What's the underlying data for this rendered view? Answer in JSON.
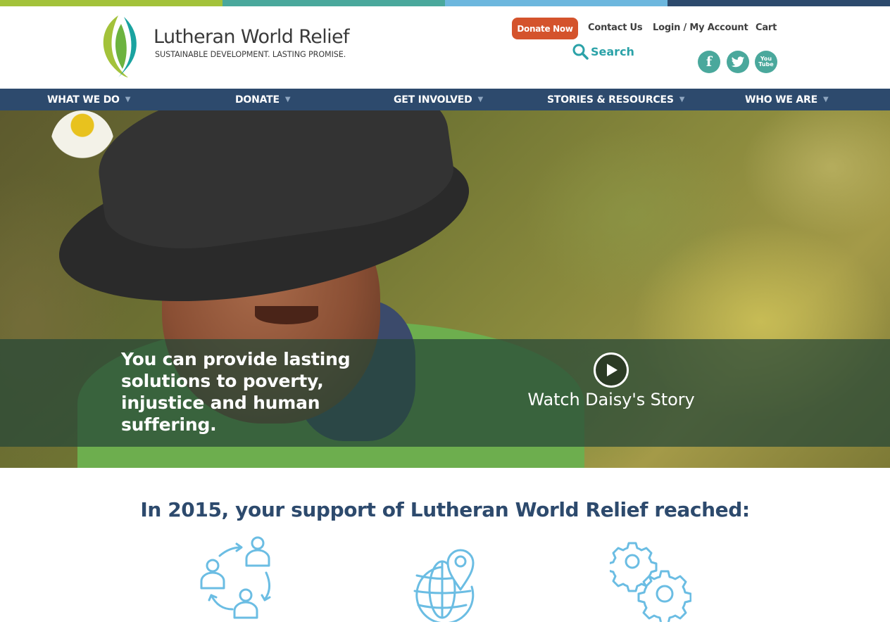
{
  "colors": {
    "strip": [
      "#a3c23a",
      "#4aa89c",
      "#6db7de",
      "#2d4a6d"
    ],
    "donate": "#d4532c",
    "nav": "#2d4a6d",
    "search": "#2ba2a8",
    "social": "#4aa89c",
    "stat_icon": "#6bbde3"
  },
  "header": {
    "logo_name": "Lutheran World Relief",
    "logo_tagline": "SUSTAINABLE DEVELOPMENT. LASTING PROMISE.",
    "donate_label": "Donate Now",
    "contact_label": "Contact Us",
    "login_label": "Login / My Account",
    "cart_label": "Cart",
    "search_label": "Search",
    "social": [
      {
        "name": "facebook-icon",
        "glyph": "f"
      },
      {
        "name": "twitter-icon",
        "glyph": ""
      },
      {
        "name": "youtube-icon",
        "glyph": "You Tube"
      }
    ]
  },
  "nav": {
    "items": [
      {
        "label": "WHAT WE DO"
      },
      {
        "label": "DONATE"
      },
      {
        "label": "GET INVOLVED"
      },
      {
        "label": "STORIES & RESOURCES"
      },
      {
        "label": "WHO WE ARE"
      }
    ],
    "caret": "▼"
  },
  "hero": {
    "tagline": "You can provide lasting solutions to poverty, injustice and human suffering.",
    "video_label": "Watch Daisy's Story"
  },
  "stats": {
    "title": "In 2015, your support of Lutheran World Relief reached:",
    "icons": [
      "people-cycle-icon",
      "globe-pin-icon",
      "gears-icon"
    ]
  }
}
